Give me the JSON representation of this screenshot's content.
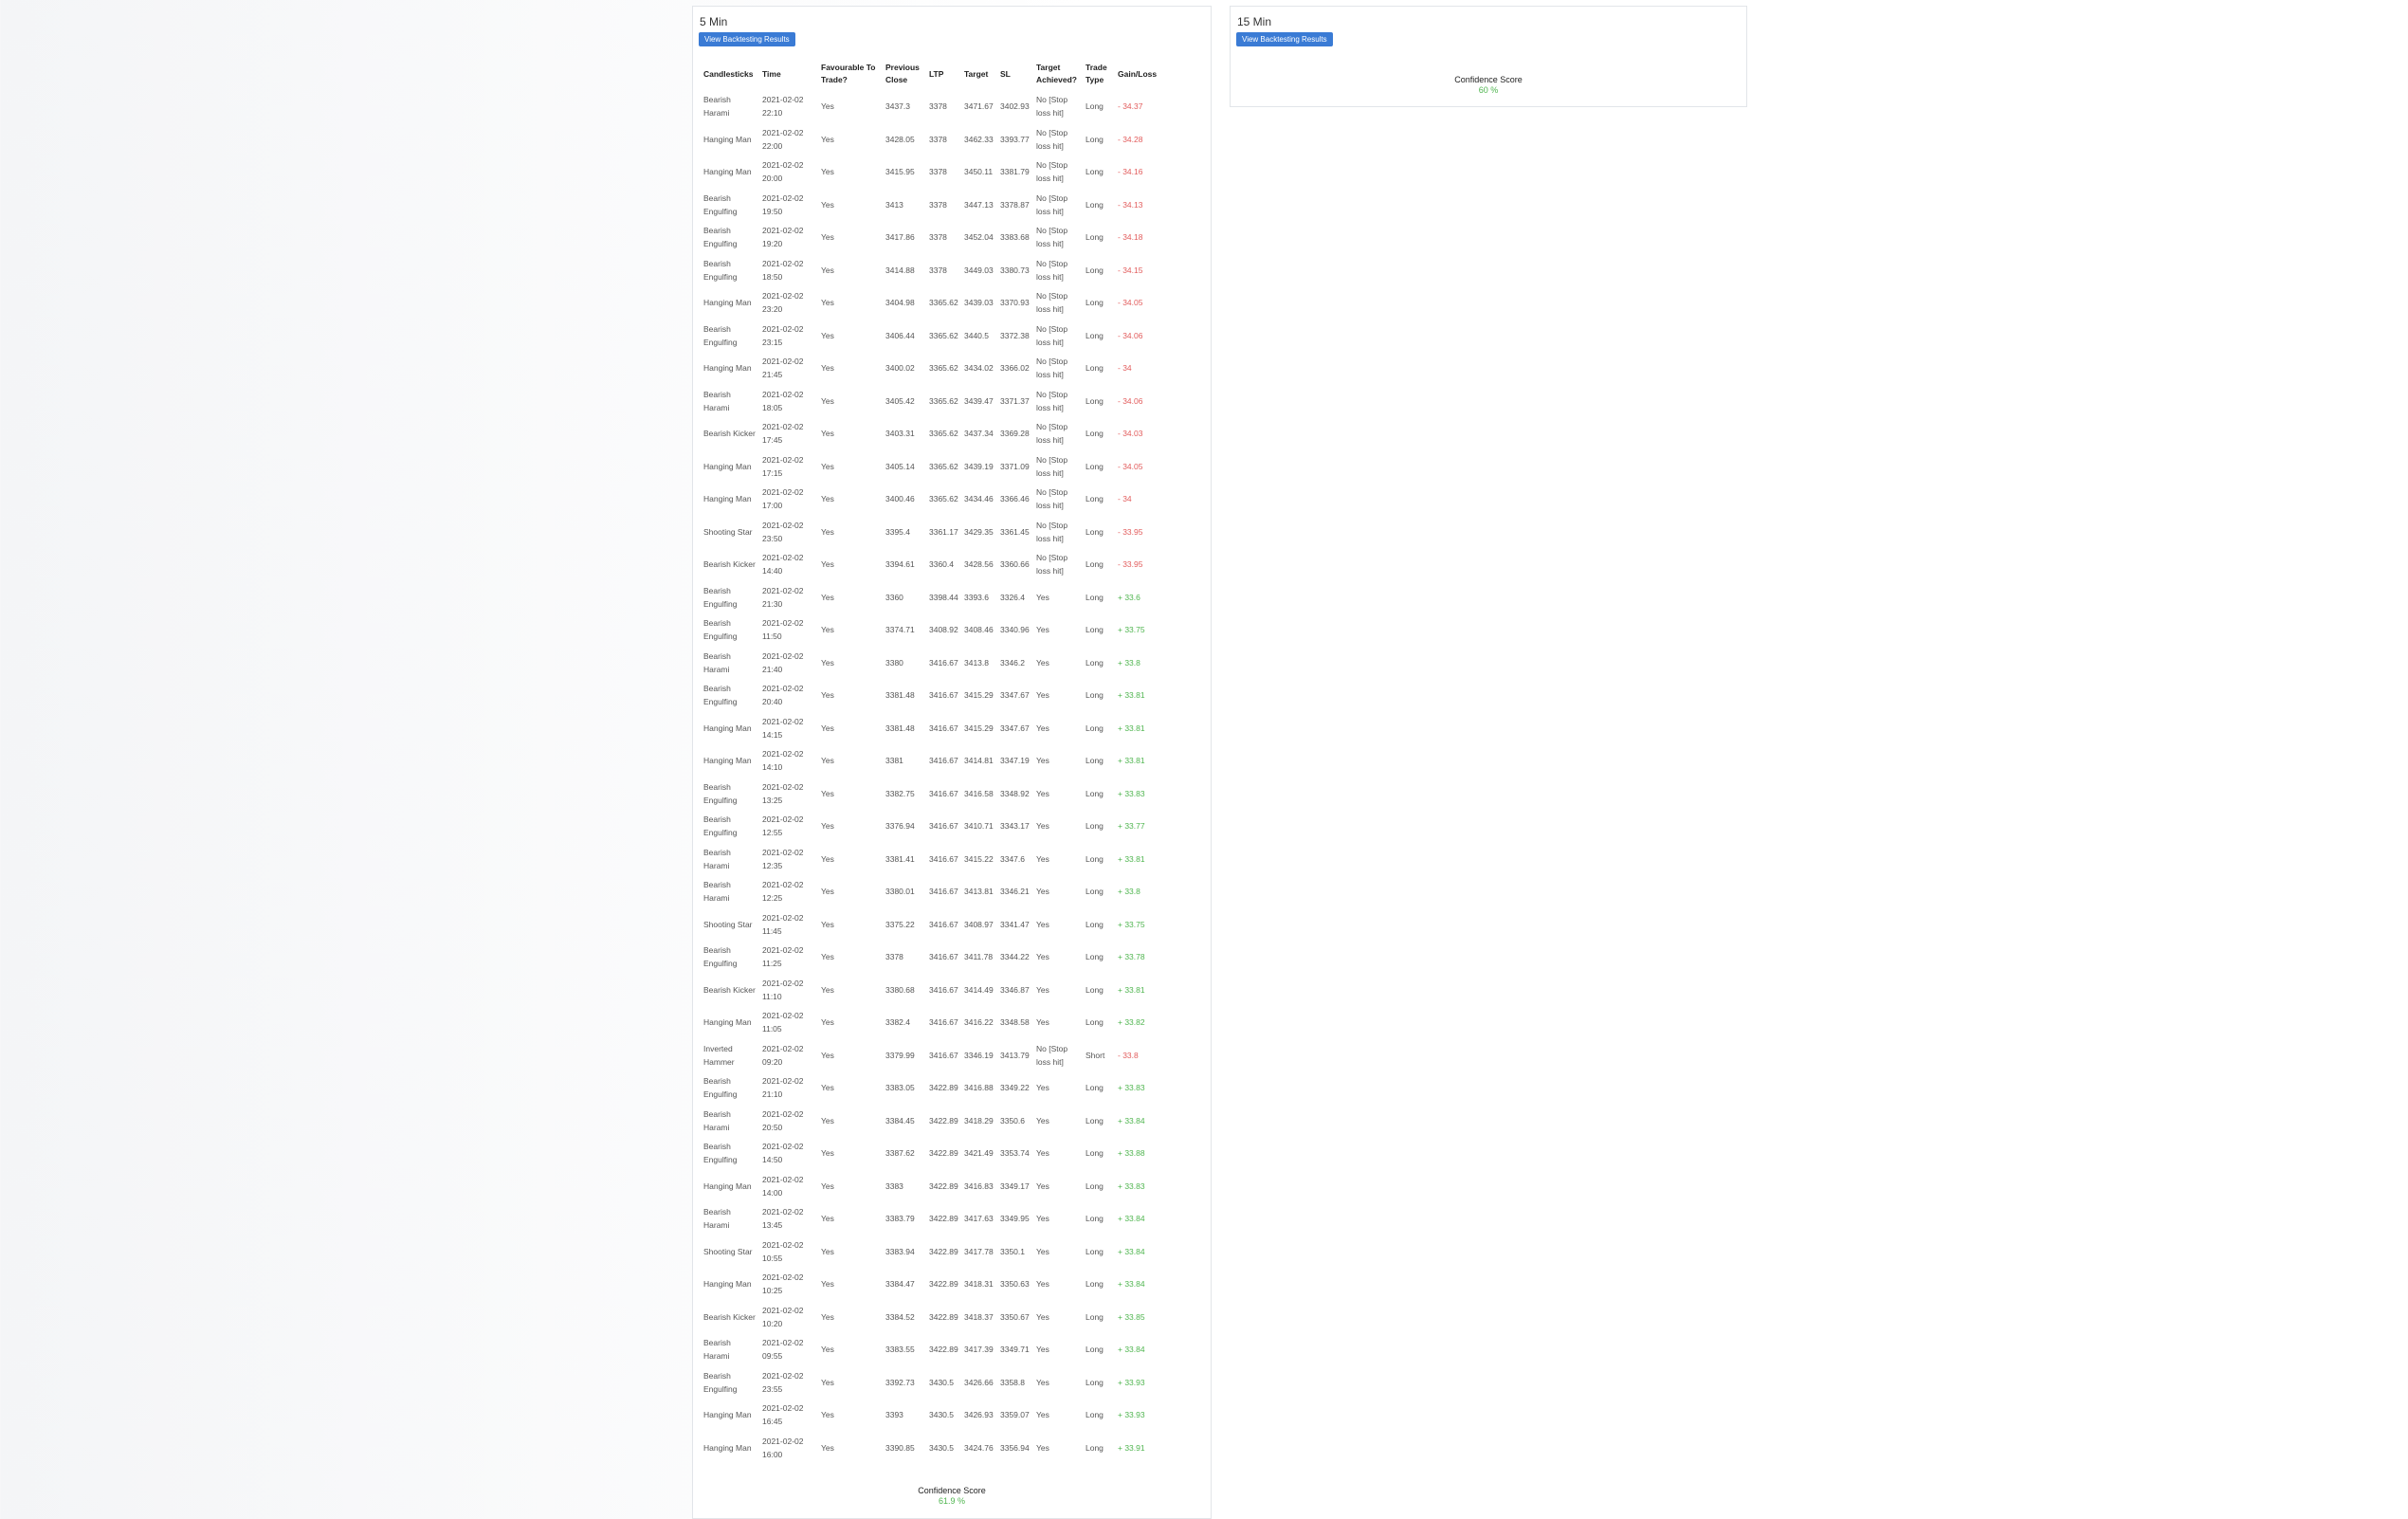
{
  "panel_5min": {
    "title": "5 Min",
    "button_label": "View Backtesting Results",
    "headers": [
      "Candlesticks",
      "Time",
      "Favourable To Trade?",
      "Previous Close",
      "LTP",
      "Target",
      "SL",
      "Target Achieved?",
      "Trade Type",
      "Gain/Loss"
    ],
    "confidence_label": "Confidence Score",
    "confidence_value": "61.9 %",
    "rows": [
      {
        "c": "Bearish Harami",
        "t": "2021-02-02 22:10",
        "f": "Yes",
        "pc": "3437.3",
        "ltp": "3378",
        "tg": "3471.67",
        "sl": "3402.93",
        "ta": "No [Stop loss hit]",
        "tt": "Long",
        "gl": "- 34.37",
        "s": "neg"
      },
      {
        "c": "Hanging Man",
        "t": "2021-02-02 22:00",
        "f": "Yes",
        "pc": "3428.05",
        "ltp": "3378",
        "tg": "3462.33",
        "sl": "3393.77",
        "ta": "No [Stop loss hit]",
        "tt": "Long",
        "gl": "- 34.28",
        "s": "neg"
      },
      {
        "c": "Hanging Man",
        "t": "2021-02-02 20:00",
        "f": "Yes",
        "pc": "3415.95",
        "ltp": "3378",
        "tg": "3450.11",
        "sl": "3381.79",
        "ta": "No [Stop loss hit]",
        "tt": "Long",
        "gl": "- 34.16",
        "s": "neg"
      },
      {
        "c": "Bearish Engulfing",
        "t": "2021-02-02 19:50",
        "f": "Yes",
        "pc": "3413",
        "ltp": "3378",
        "tg": "3447.13",
        "sl": "3378.87",
        "ta": "No [Stop loss hit]",
        "tt": "Long",
        "gl": "- 34.13",
        "s": "neg"
      },
      {
        "c": "Bearish Engulfing",
        "t": "2021-02-02 19:20",
        "f": "Yes",
        "pc": "3417.86",
        "ltp": "3378",
        "tg": "3452.04",
        "sl": "3383.68",
        "ta": "No [Stop loss hit]",
        "tt": "Long",
        "gl": "- 34.18",
        "s": "neg"
      },
      {
        "c": "Bearish Engulfing",
        "t": "2021-02-02 18:50",
        "f": "Yes",
        "pc": "3414.88",
        "ltp": "3378",
        "tg": "3449.03",
        "sl": "3380.73",
        "ta": "No [Stop loss hit]",
        "tt": "Long",
        "gl": "- 34.15",
        "s": "neg"
      },
      {
        "c": "Hanging Man",
        "t": "2021-02-02 23:20",
        "f": "Yes",
        "pc": "3404.98",
        "ltp": "3365.62",
        "tg": "3439.03",
        "sl": "3370.93",
        "ta": "No [Stop loss hit]",
        "tt": "Long",
        "gl": "- 34.05",
        "s": "neg"
      },
      {
        "c": "Bearish Engulfing",
        "t": "2021-02-02 23:15",
        "f": "Yes",
        "pc": "3406.44",
        "ltp": "3365.62",
        "tg": "3440.5",
        "sl": "3372.38",
        "ta": "No [Stop loss hit]",
        "tt": "Long",
        "gl": "- 34.06",
        "s": "neg"
      },
      {
        "c": "Hanging Man",
        "t": "2021-02-02 21:45",
        "f": "Yes",
        "pc": "3400.02",
        "ltp": "3365.62",
        "tg": "3434.02",
        "sl": "3366.02",
        "ta": "No [Stop loss hit]",
        "tt": "Long",
        "gl": "- 34",
        "s": "neg"
      },
      {
        "c": "Bearish Harami",
        "t": "2021-02-02 18:05",
        "f": "Yes",
        "pc": "3405.42",
        "ltp": "3365.62",
        "tg": "3439.47",
        "sl": "3371.37",
        "ta": "No [Stop loss hit]",
        "tt": "Long",
        "gl": "- 34.06",
        "s": "neg"
      },
      {
        "c": "Bearish Kicker",
        "t": "2021-02-02 17:45",
        "f": "Yes",
        "pc": "3403.31",
        "ltp": "3365.62",
        "tg": "3437.34",
        "sl": "3369.28",
        "ta": "No [Stop loss hit]",
        "tt": "Long",
        "gl": "- 34.03",
        "s": "neg"
      },
      {
        "c": "Hanging Man",
        "t": "2021-02-02 17:15",
        "f": "Yes",
        "pc": "3405.14",
        "ltp": "3365.62",
        "tg": "3439.19",
        "sl": "3371.09",
        "ta": "No [Stop loss hit]",
        "tt": "Long",
        "gl": "- 34.05",
        "s": "neg"
      },
      {
        "c": "Hanging Man",
        "t": "2021-02-02 17:00",
        "f": "Yes",
        "pc": "3400.46",
        "ltp": "3365.62",
        "tg": "3434.46",
        "sl": "3366.46",
        "ta": "No [Stop loss hit]",
        "tt": "Long",
        "gl": "- 34",
        "s": "neg"
      },
      {
        "c": "Shooting Star",
        "t": "2021-02-02 23:50",
        "f": "Yes",
        "pc": "3395.4",
        "ltp": "3361.17",
        "tg": "3429.35",
        "sl": "3361.45",
        "ta": "No [Stop loss hit]",
        "tt": "Long",
        "gl": "- 33.95",
        "s": "neg"
      },
      {
        "c": "Bearish Kicker",
        "t": "2021-02-02 14:40",
        "f": "Yes",
        "pc": "3394.61",
        "ltp": "3360.4",
        "tg": "3428.56",
        "sl": "3360.66",
        "ta": "No [Stop loss hit]",
        "tt": "Long",
        "gl": "- 33.95",
        "s": "neg"
      },
      {
        "c": "Bearish Engulfing",
        "t": "2021-02-02 21:30",
        "f": "Yes",
        "pc": "3360",
        "ltp": "3398.44",
        "tg": "3393.6",
        "sl": "3326.4",
        "ta": "Yes",
        "tt": "Long",
        "gl": "+ 33.6",
        "s": "pos"
      },
      {
        "c": "Bearish Engulfing",
        "t": "2021-02-02 11:50",
        "f": "Yes",
        "pc": "3374.71",
        "ltp": "3408.92",
        "tg": "3408.46",
        "sl": "3340.96",
        "ta": "Yes",
        "tt": "Long",
        "gl": "+ 33.75",
        "s": "pos"
      },
      {
        "c": "Bearish Harami",
        "t": "2021-02-02 21:40",
        "f": "Yes",
        "pc": "3380",
        "ltp": "3416.67",
        "tg": "3413.8",
        "sl": "3346.2",
        "ta": "Yes",
        "tt": "Long",
        "gl": "+ 33.8",
        "s": "pos"
      },
      {
        "c": "Bearish Engulfing",
        "t": "2021-02-02 20:40",
        "f": "Yes",
        "pc": "3381.48",
        "ltp": "3416.67",
        "tg": "3415.29",
        "sl": "3347.67",
        "ta": "Yes",
        "tt": "Long",
        "gl": "+ 33.81",
        "s": "pos"
      },
      {
        "c": "Hanging Man",
        "t": "2021-02-02 14:15",
        "f": "Yes",
        "pc": "3381.48",
        "ltp": "3416.67",
        "tg": "3415.29",
        "sl": "3347.67",
        "ta": "Yes",
        "tt": "Long",
        "gl": "+ 33.81",
        "s": "pos"
      },
      {
        "c": "Hanging Man",
        "t": "2021-02-02 14:10",
        "f": "Yes",
        "pc": "3381",
        "ltp": "3416.67",
        "tg": "3414.81",
        "sl": "3347.19",
        "ta": "Yes",
        "tt": "Long",
        "gl": "+ 33.81",
        "s": "pos"
      },
      {
        "c": "Bearish Engulfing",
        "t": "2021-02-02 13:25",
        "f": "Yes",
        "pc": "3382.75",
        "ltp": "3416.67",
        "tg": "3416.58",
        "sl": "3348.92",
        "ta": "Yes",
        "tt": "Long",
        "gl": "+ 33.83",
        "s": "pos"
      },
      {
        "c": "Bearish Engulfing",
        "t": "2021-02-02 12:55",
        "f": "Yes",
        "pc": "3376.94",
        "ltp": "3416.67",
        "tg": "3410.71",
        "sl": "3343.17",
        "ta": "Yes",
        "tt": "Long",
        "gl": "+ 33.77",
        "s": "pos"
      },
      {
        "c": "Bearish Harami",
        "t": "2021-02-02 12:35",
        "f": "Yes",
        "pc": "3381.41",
        "ltp": "3416.67",
        "tg": "3415.22",
        "sl": "3347.6",
        "ta": "Yes",
        "tt": "Long",
        "gl": "+ 33.81",
        "s": "pos"
      },
      {
        "c": "Bearish Harami",
        "t": "2021-02-02 12:25",
        "f": "Yes",
        "pc": "3380.01",
        "ltp": "3416.67",
        "tg": "3413.81",
        "sl": "3346.21",
        "ta": "Yes",
        "tt": "Long",
        "gl": "+ 33.8",
        "s": "pos"
      },
      {
        "c": "Shooting Star",
        "t": "2021-02-02 11:45",
        "f": "Yes",
        "pc": "3375.22",
        "ltp": "3416.67",
        "tg": "3408.97",
        "sl": "3341.47",
        "ta": "Yes",
        "tt": "Long",
        "gl": "+ 33.75",
        "s": "pos"
      },
      {
        "c": "Bearish Engulfing",
        "t": "2021-02-02 11:25",
        "f": "Yes",
        "pc": "3378",
        "ltp": "3416.67",
        "tg": "3411.78",
        "sl": "3344.22",
        "ta": "Yes",
        "tt": "Long",
        "gl": "+ 33.78",
        "s": "pos"
      },
      {
        "c": "Bearish Kicker",
        "t": "2021-02-02 11:10",
        "f": "Yes",
        "pc": "3380.68",
        "ltp": "3416.67",
        "tg": "3414.49",
        "sl": "3346.87",
        "ta": "Yes",
        "tt": "Long",
        "gl": "+ 33.81",
        "s": "pos"
      },
      {
        "c": "Hanging Man",
        "t": "2021-02-02 11:05",
        "f": "Yes",
        "pc": "3382.4",
        "ltp": "3416.67",
        "tg": "3416.22",
        "sl": "3348.58",
        "ta": "Yes",
        "tt": "Long",
        "gl": "+ 33.82",
        "s": "pos"
      },
      {
        "c": "Inverted Hammer",
        "t": "2021-02-02 09:20",
        "f": "Yes",
        "pc": "3379.99",
        "ltp": "3416.67",
        "tg": "3346.19",
        "sl": "3413.79",
        "ta": "No [Stop loss hit]",
        "tt": "Short",
        "gl": "- 33.8",
        "s": "neg"
      },
      {
        "c": "Bearish Engulfing",
        "t": "2021-02-02 21:10",
        "f": "Yes",
        "pc": "3383.05",
        "ltp": "3422.89",
        "tg": "3416.88",
        "sl": "3349.22",
        "ta": "Yes",
        "tt": "Long",
        "gl": "+ 33.83",
        "s": "pos"
      },
      {
        "c": "Bearish Harami",
        "t": "2021-02-02 20:50",
        "f": "Yes",
        "pc": "3384.45",
        "ltp": "3422.89",
        "tg": "3418.29",
        "sl": "3350.6",
        "ta": "Yes",
        "tt": "Long",
        "gl": "+ 33.84",
        "s": "pos"
      },
      {
        "c": "Bearish Engulfing",
        "t": "2021-02-02 14:50",
        "f": "Yes",
        "pc": "3387.62",
        "ltp": "3422.89",
        "tg": "3421.49",
        "sl": "3353.74",
        "ta": "Yes",
        "tt": "Long",
        "gl": "+ 33.88",
        "s": "pos"
      },
      {
        "c": "Hanging Man",
        "t": "2021-02-02 14:00",
        "f": "Yes",
        "pc": "3383",
        "ltp": "3422.89",
        "tg": "3416.83",
        "sl": "3349.17",
        "ta": "Yes",
        "tt": "Long",
        "gl": "+ 33.83",
        "s": "pos"
      },
      {
        "c": "Bearish Harami",
        "t": "2021-02-02 13:45",
        "f": "Yes",
        "pc": "3383.79",
        "ltp": "3422.89",
        "tg": "3417.63",
        "sl": "3349.95",
        "ta": "Yes",
        "tt": "Long",
        "gl": "+ 33.84",
        "s": "pos"
      },
      {
        "c": "Shooting Star",
        "t": "2021-02-02 10:55",
        "f": "Yes",
        "pc": "3383.94",
        "ltp": "3422.89",
        "tg": "3417.78",
        "sl": "3350.1",
        "ta": "Yes",
        "tt": "Long",
        "gl": "+ 33.84",
        "s": "pos"
      },
      {
        "c": "Hanging Man",
        "t": "2021-02-02 10:25",
        "f": "Yes",
        "pc": "3384.47",
        "ltp": "3422.89",
        "tg": "3418.31",
        "sl": "3350.63",
        "ta": "Yes",
        "tt": "Long",
        "gl": "+ 33.84",
        "s": "pos"
      },
      {
        "c": "Bearish Kicker",
        "t": "2021-02-02 10:20",
        "f": "Yes",
        "pc": "3384.52",
        "ltp": "3422.89",
        "tg": "3418.37",
        "sl": "3350.67",
        "ta": "Yes",
        "tt": "Long",
        "gl": "+ 33.85",
        "s": "pos"
      },
      {
        "c": "Bearish Harami",
        "t": "2021-02-02 09:55",
        "f": "Yes",
        "pc": "3383.55",
        "ltp": "3422.89",
        "tg": "3417.39",
        "sl": "3349.71",
        "ta": "Yes",
        "tt": "Long",
        "gl": "+ 33.84",
        "s": "pos"
      },
      {
        "c": "Bearish Engulfing",
        "t": "2021-02-02 23:55",
        "f": "Yes",
        "pc": "3392.73",
        "ltp": "3430.5",
        "tg": "3426.66",
        "sl": "3358.8",
        "ta": "Yes",
        "tt": "Long",
        "gl": "+ 33.93",
        "s": "pos"
      },
      {
        "c": "Hanging Man",
        "t": "2021-02-02 16:45",
        "f": "Yes",
        "pc": "3393",
        "ltp": "3430.5",
        "tg": "3426.93",
        "sl": "3359.07",
        "ta": "Yes",
        "tt": "Long",
        "gl": "+ 33.93",
        "s": "pos"
      },
      {
        "c": "Hanging Man",
        "t": "2021-02-02 16:00",
        "f": "Yes",
        "pc": "3390.85",
        "ltp": "3430.5",
        "tg": "3424.76",
        "sl": "3356.94",
        "ta": "Yes",
        "tt": "Long",
        "gl": "+ 33.91",
        "s": "pos"
      }
    ]
  },
  "panel_15min": {
    "title": "15 Min",
    "button_label": "View Backtesting Results",
    "confidence_label": "Confidence Score",
    "confidence_value": "60 %"
  },
  "colors": {
    "button": "#3a7bd5",
    "negative": "#e25c5c",
    "positive": "#4fb54f"
  }
}
